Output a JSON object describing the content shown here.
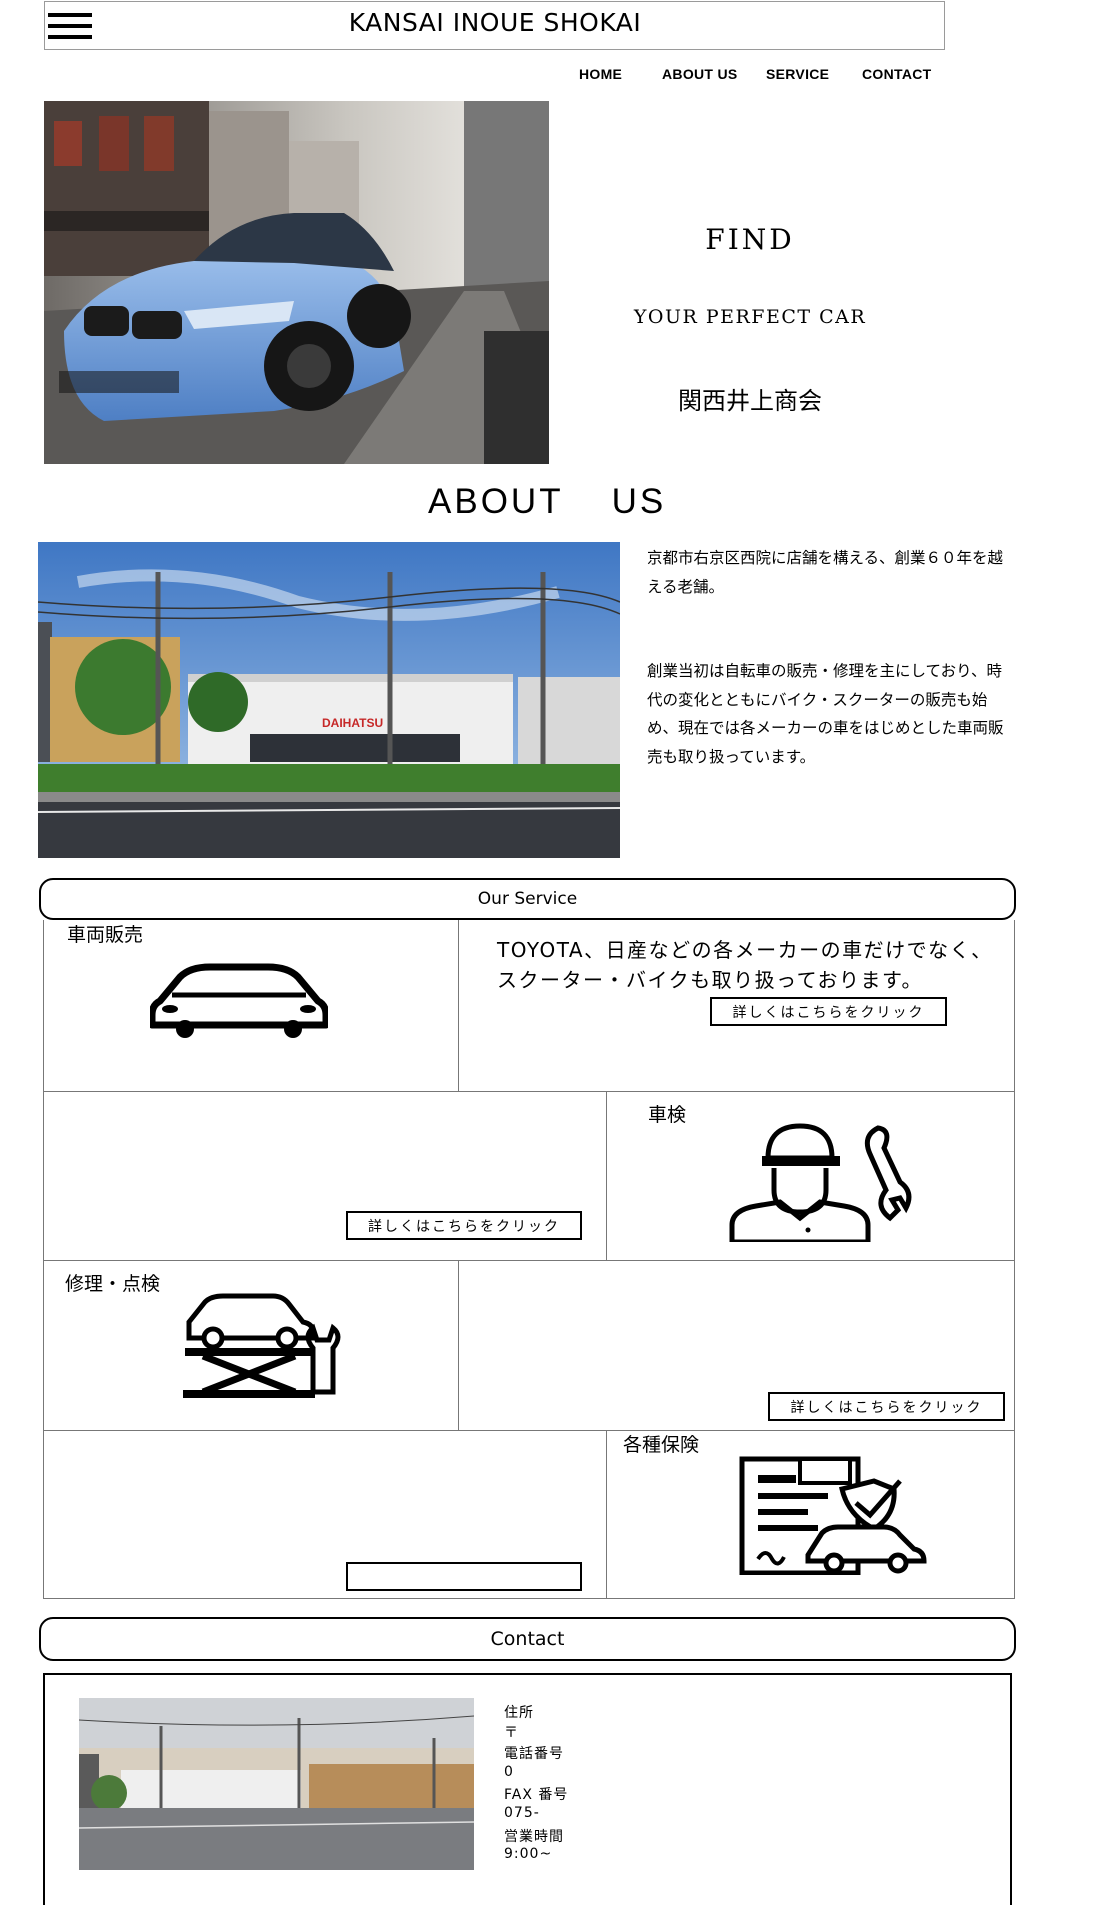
{
  "header": {
    "title": "KANSAI INOUE SHOKAI",
    "menu_icon": "hamburger-menu-icon"
  },
  "nav": [
    "HOME",
    "ABOUT US",
    "SERVICE",
    "CONTACT"
  ],
  "hero": {
    "headline": "FIND",
    "subheadline": "YOUR PERFECT CAR",
    "company_jp": "関西井上商会"
  },
  "about": {
    "title": "ABOUT US",
    "paragraph1": "京都市右京区西院に店舗を構える、創業６０年を越える老舗。",
    "paragraph2": "創業当初は自転車の販売・修理を主にしており、時代の変化とともにバイク・スクーターの販売も始め、現在では各メーカーの車をはじめとした車両販売も取り扱っています。",
    "photo_sign": "DAIHATSU"
  },
  "services": {
    "title": "Our Service",
    "items": [
      {
        "label": "車両販売",
        "icon": "car-icon"
      },
      {
        "label": "車検",
        "icon": "mechanic-icon"
      },
      {
        "label": "修理・点検",
        "icon": "car-lift-icon"
      },
      {
        "label": "各種保険",
        "icon": "insurance-icon"
      }
    ],
    "vehicle_desc": "TOYOTA、日産などの各メーカーの車だけでなく、スクーター・バイクも取り扱っております。",
    "detail_button": "詳しくはこちらをクリック"
  },
  "contact": {
    "title": "Contact",
    "lines": [
      "住所",
      "〒",
      "電話番号",
      "0",
      "FAX 番号",
      "075-",
      "営業時間",
      "9:00~"
    ]
  },
  "colors": {
    "border": "#777777",
    "text": "#000000",
    "background": "#ffffff"
  }
}
